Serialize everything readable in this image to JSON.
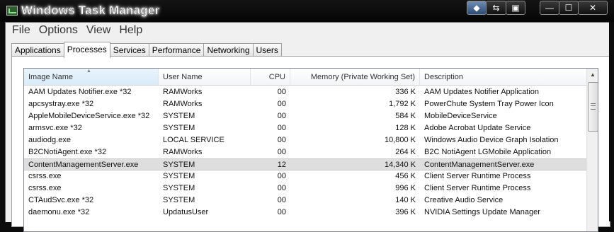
{
  "window": {
    "title": "Windows Task Manager",
    "title_buttons": [
      "◆",
      "⇆",
      "▣"
    ],
    "controls": {
      "minimize": "—",
      "maximize": "☐",
      "close": "✕"
    }
  },
  "menu": [
    "File",
    "Options",
    "View",
    "Help"
  ],
  "tabs": [
    {
      "label": "Applications",
      "active": false
    },
    {
      "label": "Processes",
      "active": true
    },
    {
      "label": "Services",
      "active": false
    },
    {
      "label": "Performance",
      "active": false
    },
    {
      "label": "Networking",
      "active": false
    },
    {
      "label": "Users",
      "active": false
    }
  ],
  "table": {
    "columns": [
      "Image Name",
      "User Name",
      "CPU",
      "Memory (Private Working Set)",
      "Description"
    ],
    "sort_indicator": "▲",
    "rows": [
      {
        "image": "AAM Updates Notifier.exe *32",
        "user": "RAMWorks",
        "cpu": "00",
        "memory": "336 K",
        "description": "AAM Updates Notifier Application",
        "selected": false
      },
      {
        "image": "apcsystray.exe *32",
        "user": "RAMWorks",
        "cpu": "00",
        "memory": "1,792 K",
        "description": "PowerChute System Tray Power Icon",
        "selected": false
      },
      {
        "image": "AppleMobileDeviceService.exe *32",
        "user": "SYSTEM",
        "cpu": "00",
        "memory": "584 K",
        "description": "MobileDeviceService",
        "selected": false
      },
      {
        "image": "armsvc.exe *32",
        "user": "SYSTEM",
        "cpu": "00",
        "memory": "128 K",
        "description": "Adobe Acrobat Update Service",
        "selected": false
      },
      {
        "image": "audiodg.exe",
        "user": "LOCAL SERVICE",
        "cpu": "00",
        "memory": "10,800 K",
        "description": "Windows Audio Device Graph Isolation",
        "selected": false
      },
      {
        "image": "B2CNotiAgent.exe *32",
        "user": "RAMWorks",
        "cpu": "00",
        "memory": "264 K",
        "description": "B2C NotiAgent LGMobile Application",
        "selected": false
      },
      {
        "image": "ContentManagementServer.exe",
        "user": "SYSTEM",
        "cpu": "12",
        "memory": "14,340 K",
        "description": "ContentManagementServer.exe",
        "selected": true
      },
      {
        "image": "csrss.exe",
        "user": "SYSTEM",
        "cpu": "00",
        "memory": "456 K",
        "description": "Client Server Runtime Process",
        "selected": false
      },
      {
        "image": "csrss.exe",
        "user": "SYSTEM",
        "cpu": "00",
        "memory": "996 K",
        "description": "Client Server Runtime Process",
        "selected": false
      },
      {
        "image": "CTAudSvc.exe *32",
        "user": "SYSTEM",
        "cpu": "00",
        "memory": "140 K",
        "description": "Creative Audio Service",
        "selected": false
      },
      {
        "image": "daemonu.exe *32",
        "user": "UpdatusUser",
        "cpu": "00",
        "memory": "396 K",
        "description": "NVIDIA Settings Update Manager",
        "selected": false
      }
    ]
  },
  "scrollbar": {
    "up_arrow": "▲",
    "grip": "≡"
  }
}
